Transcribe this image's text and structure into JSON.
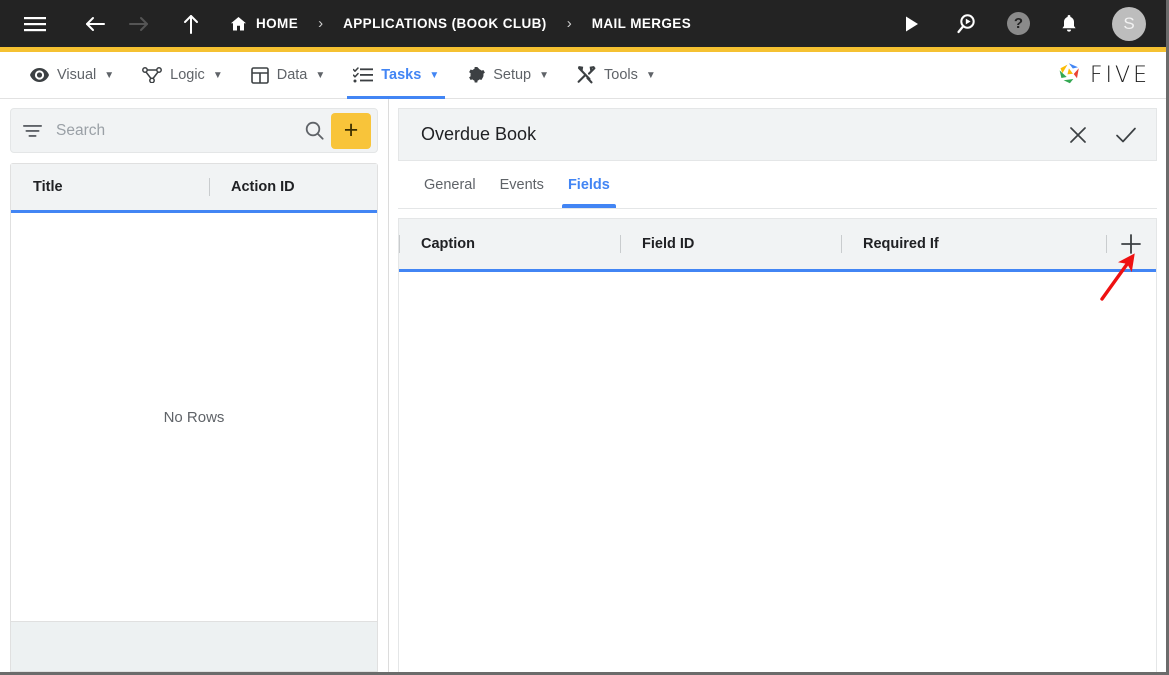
{
  "topbar": {
    "menu_icon": "hamburger-icon",
    "back_icon": "arrow-left-icon",
    "forward_icon": "arrow-right-icon",
    "up_icon": "arrow-up-icon",
    "breadcrumbs": [
      {
        "label": "HOME",
        "icon": "home-icon"
      },
      {
        "label": "APPLICATIONS (BOOK CLUB)",
        "icon": ""
      },
      {
        "label": "MAIL MERGES",
        "icon": ""
      }
    ],
    "separator": "›",
    "actions": [
      {
        "name": "run-icon",
        "label": ""
      },
      {
        "name": "search-run-icon",
        "label": ""
      },
      {
        "name": "help-icon",
        "label": "?"
      },
      {
        "name": "notifications-bell-icon",
        "label": ""
      }
    ],
    "avatar_initial": "S",
    "accent_color": "#f5c131",
    "background_color": "#232323"
  },
  "menubar": {
    "items": [
      {
        "label": "Visual",
        "icon": "eye-icon",
        "caret": "▼",
        "active": false
      },
      {
        "label": "Logic",
        "icon": "logic-nodes-icon",
        "caret": "▼",
        "active": false
      },
      {
        "label": "Data",
        "icon": "table-grid-icon",
        "caret": "▼",
        "active": false
      },
      {
        "label": "Tasks",
        "icon": "checklist-icon",
        "caret": "▼",
        "active": true
      },
      {
        "label": "Setup",
        "icon": "gear-icon",
        "caret": "▼",
        "active": false
      },
      {
        "label": "Tools",
        "icon": "tools-icon",
        "caret": "▼",
        "active": false
      }
    ],
    "brand": {
      "word": "FIVE",
      "logo": "five-pinwheel-logo"
    },
    "active_color": "#4285f4"
  },
  "left_panel": {
    "search": {
      "placeholder": "Search",
      "value": ""
    },
    "filter_icon": "filter-icon",
    "search_icon": "search-icon",
    "add_button_label": "+",
    "add_button_color": "#f8c43a",
    "columns": [
      "Title",
      "Action ID"
    ],
    "rows": [],
    "empty_message": "No Rows"
  },
  "right_panel": {
    "title": "Overdue Book",
    "actions": [
      {
        "name": "close-icon",
        "glyph": "✕"
      },
      {
        "name": "confirm-check-icon",
        "glyph": "✓"
      }
    ],
    "tabs": [
      {
        "label": "General",
        "active": false
      },
      {
        "label": "Events",
        "active": false
      },
      {
        "label": "Fields",
        "active": true
      }
    ],
    "fields_grid": {
      "columns": [
        "Caption",
        "Field ID",
        "Required If"
      ],
      "add_column_icon": "plus-icon",
      "rows": []
    },
    "annotation": {
      "type": "arrow",
      "color": "#ee1111",
      "points_to": "plus-icon"
    }
  }
}
